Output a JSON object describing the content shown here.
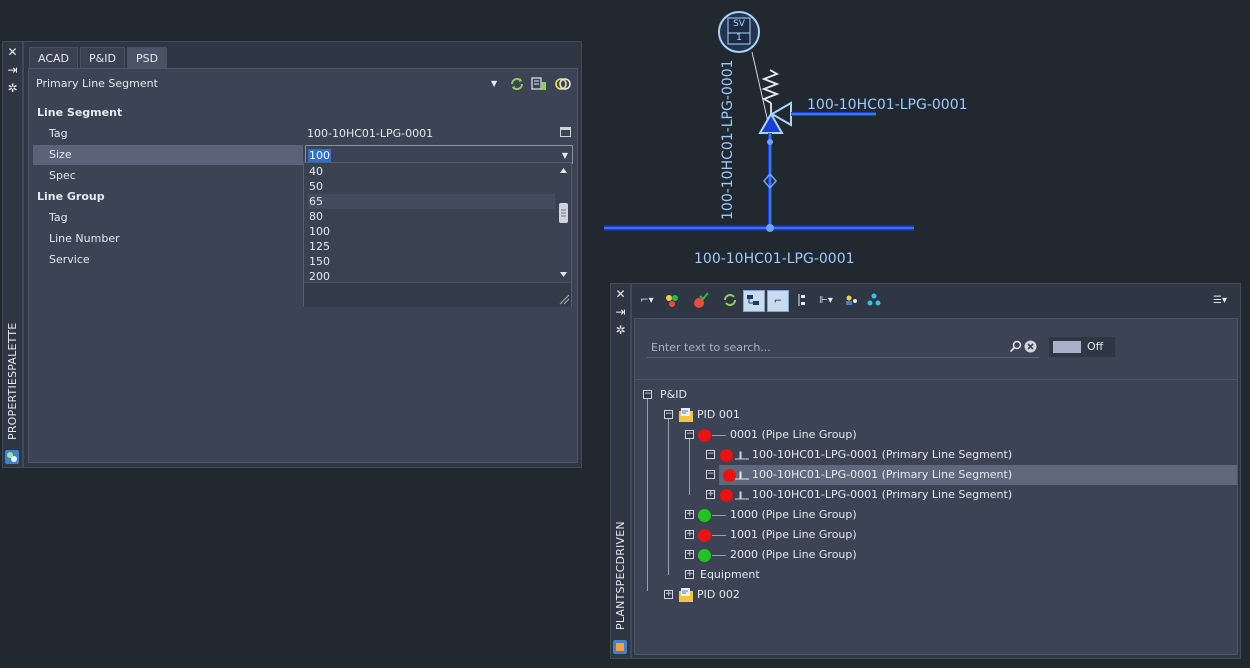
{
  "properties_palette": {
    "vertical_title": "PROPERTIESPALETTE",
    "tabs": [
      "ACAD",
      "P&ID",
      "PSD"
    ],
    "active_tab": "PSD",
    "object_type": "Primary Line Segment",
    "categories": {
      "line_segment": "Line Segment",
      "line_group": "Line Group"
    },
    "rows": {
      "seg_tag": {
        "label": "Tag",
        "value": "100-10HC01-LPG-0001"
      },
      "seg_size": {
        "label": "Size",
        "value": "100"
      },
      "seg_spec": {
        "label": "Spec",
        "value": ""
      },
      "grp_tag": {
        "label": "Tag",
        "value": ""
      },
      "grp_line_number": {
        "label": "Line Number",
        "value": ""
      },
      "grp_service": {
        "label": "Service",
        "value": ""
      }
    },
    "size_options": [
      "40",
      "50",
      "65",
      "80",
      "100",
      "125",
      "150",
      "200"
    ]
  },
  "drawing": {
    "valve_tag_top": "SV",
    "valve_tag_bottom": "1",
    "label_right": "100-10HC01-LPG-0001",
    "label_vertical": "100-10HC01-LPG-0001",
    "label_bottom": "100-10HC01-LPG-0001",
    "line_color": "#1a3fd6",
    "label_color": "#9ecbff"
  },
  "plantspec": {
    "vertical_title": "PLANTSPECDRIVEN",
    "search_placeholder": "Enter text to search...",
    "toggle_label": "Off",
    "tree": {
      "root": "P&ID",
      "pid001": "PID 001",
      "g0001": "0001 (Pipe Line Group)",
      "seg1": "100-10HC01-LPG-0001 (Primary Line Segment)",
      "seg2": "100-10HC01-LPG-0001 (Primary Line Segment)",
      "seg3": "100-10HC01-LPG-0001 (Primary Line Segment)",
      "g1000": "1000 (Pipe Line Group)",
      "g1001": "1001 (Pipe Line Group)",
      "g2000": "2000 (Pipe Line Group)",
      "equipment": "Equipment",
      "pid002": "PID 002"
    },
    "status_colors": {
      "red": "#ee1111",
      "green": "#22c422"
    }
  }
}
